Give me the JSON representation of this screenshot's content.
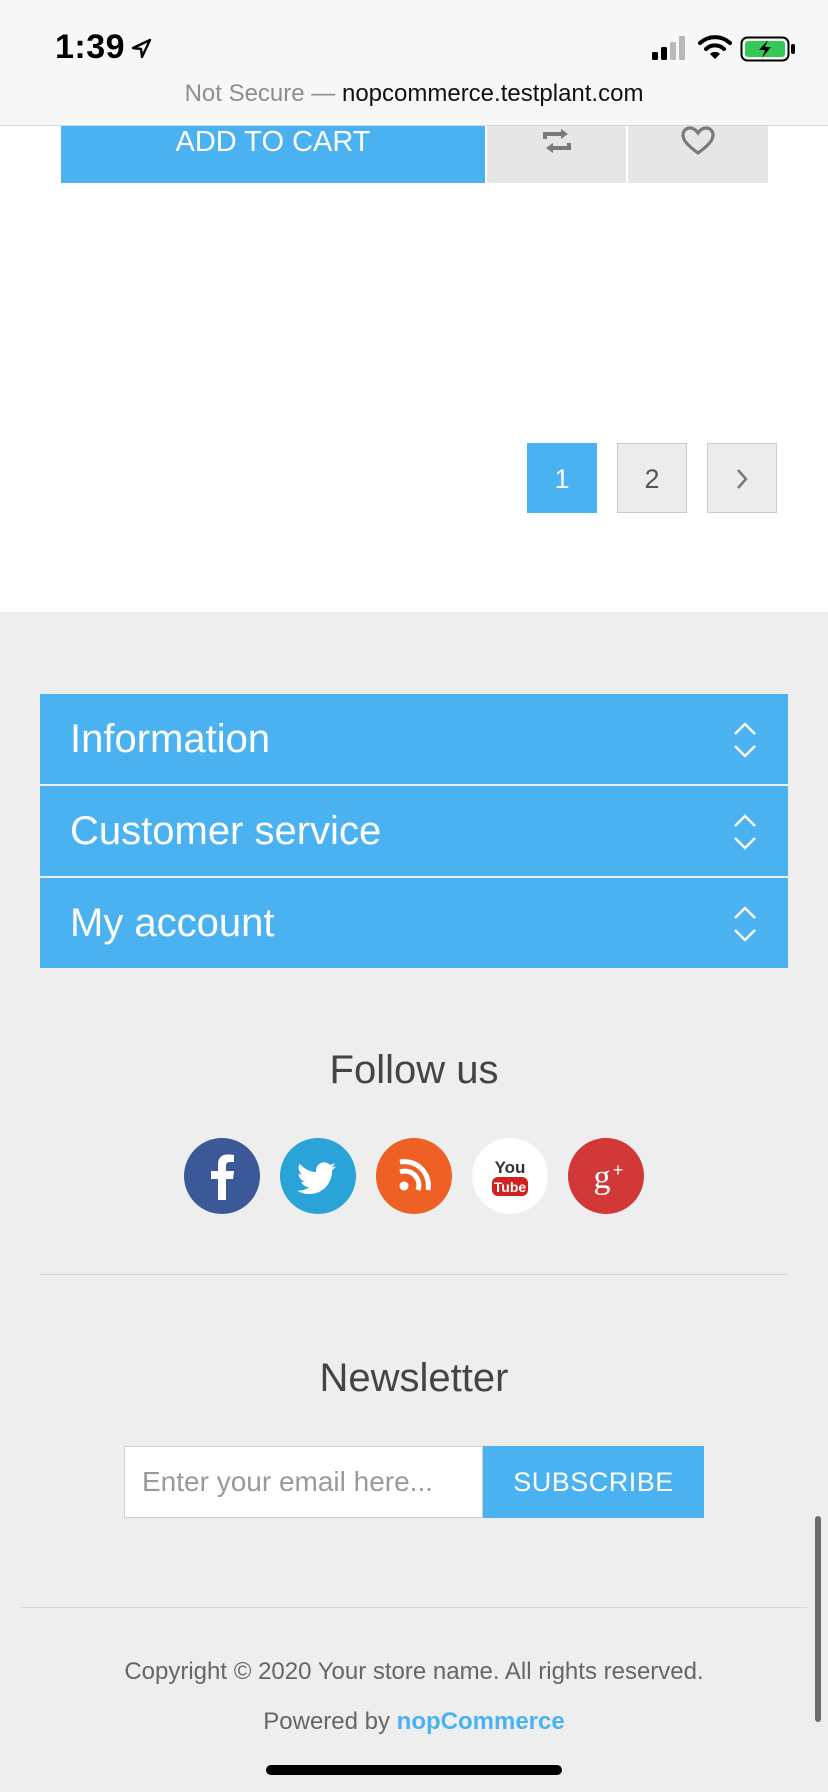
{
  "status_bar": {
    "time": "1:39",
    "url_prefix": "Not Secure — ",
    "url_host": "nopcommerce.testplant.com",
    "icons": [
      "location-arrow-icon",
      "cellular-signal-icon",
      "wifi-icon",
      "battery-charging-icon"
    ]
  },
  "product_actions": {
    "add_to_cart": "ADD TO CART",
    "compare_icon": "compare-arrows-icon",
    "wishlist_icon": "heart-icon"
  },
  "pager": {
    "pages": [
      "1",
      "2"
    ],
    "current": "1",
    "next_icon": "chevron-right-icon"
  },
  "footer": {
    "sections": [
      {
        "label": "Information"
      },
      {
        "label": "Customer service"
      },
      {
        "label": "My account"
      }
    ],
    "follow_title": "Follow us",
    "social": [
      "facebook",
      "twitter",
      "rss",
      "youtube",
      "google-plus"
    ],
    "newsletter_title": "Newsletter",
    "email_placeholder": "Enter your email here...",
    "subscribe_label": "SUBSCRIBE",
    "copyright": "Copyright © 2020 Your store name. All rights reserved.",
    "powered_prefix": "Powered by ",
    "powered_link": "nopCommerce"
  },
  "colors": {
    "accent": "#4ab2f1",
    "footer_bg": "#eeeeee",
    "facebook": "#3b5998",
    "twitter": "#2aa3d8",
    "rss": "#ee6024",
    "youtube": "#ffffff",
    "google_plus": "#d23838"
  }
}
